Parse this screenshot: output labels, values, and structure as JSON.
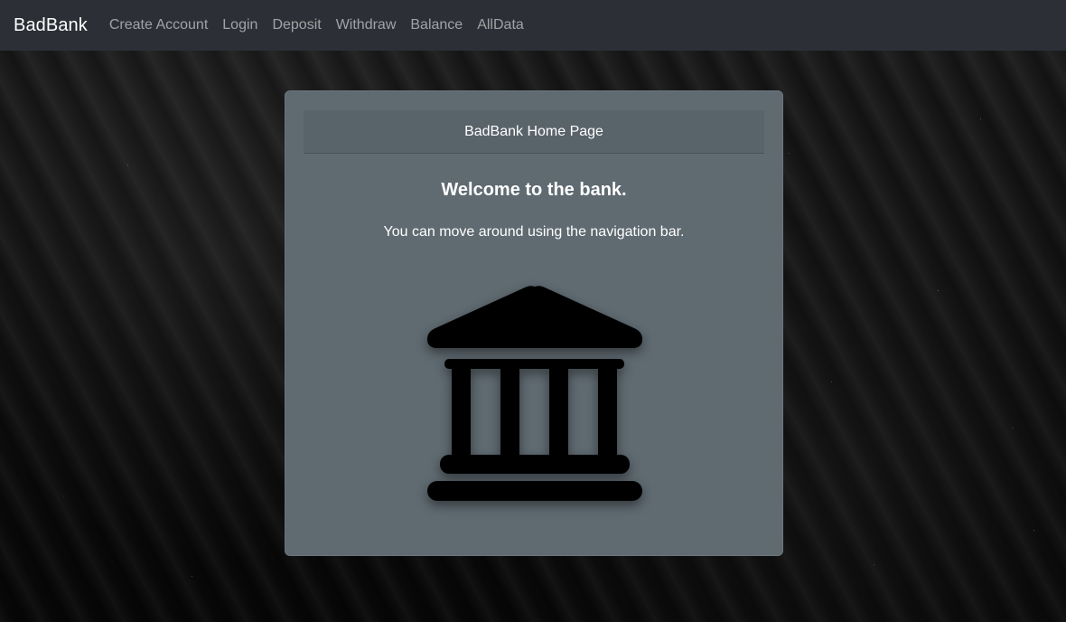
{
  "navbar": {
    "brand": "BadBank",
    "links": [
      {
        "label": "Create Account"
      },
      {
        "label": "Login"
      },
      {
        "label": "Deposit"
      },
      {
        "label": "Withdraw"
      },
      {
        "label": "Balance"
      },
      {
        "label": "AllData"
      }
    ]
  },
  "card": {
    "header": "BadBank Home Page",
    "title": "Welcome to the bank.",
    "text": "You can move around using the navigation bar.",
    "icon": "bank-icon"
  },
  "colors": {
    "navbar_bg": "#2c3036",
    "card_bg": "#5f6a71",
    "card_header_bg": "#59636a",
    "text": "#ffffff",
    "nav_link": "rgba(255,255,255,0.55)"
  }
}
